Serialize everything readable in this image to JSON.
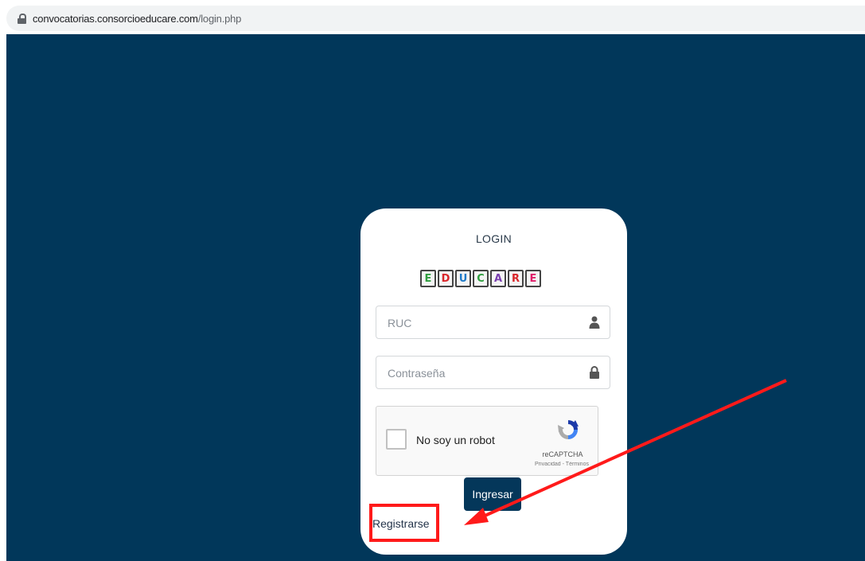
{
  "browser": {
    "url_domain": "convocatorias.consorcioeducare.com",
    "url_path": "/login.php"
  },
  "login": {
    "title": "LOGIN",
    "logo_letters": [
      "E",
      "D",
      "U",
      "C",
      "A",
      "R",
      "E"
    ],
    "ruc_placeholder": "RUC",
    "password_placeholder": "Contraseña",
    "submit_label": "Ingresar",
    "register_label": "Registrarse"
  },
  "captcha": {
    "label": "No soy un robot",
    "brand": "reCAPTCHA",
    "terms": "Privacidad - Términos"
  },
  "colors": {
    "page_bg": "#01375a",
    "button_bg": "#04375a",
    "highlight": "#ff1a1a",
    "logo_colors": [
      "#2f9e3f",
      "#d9262a",
      "#1f7ac8",
      "#2f9e3f",
      "#7a3fb0",
      "#d9262a",
      "#e01f6a"
    ]
  },
  "icons": {
    "ruc": "user-icon",
    "password": "lock-icon",
    "captcha": "recaptcha-logo-icon",
    "annotation": "red-arrow-icon"
  }
}
